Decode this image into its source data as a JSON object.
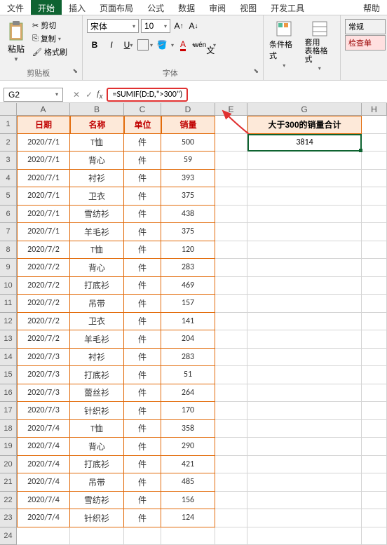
{
  "menu": {
    "file": "文件",
    "home": "开始",
    "insert": "插入",
    "layout": "页面布局",
    "formula": "公式",
    "data": "数据",
    "review": "审阅",
    "view": "视图",
    "dev": "开发工具",
    "help": "帮助"
  },
  "ribbon": {
    "clipboard": {
      "paste": "粘贴",
      "cut": "剪切",
      "copy": "复制",
      "painter": "格式刷",
      "label": "剪贴板"
    },
    "font": {
      "name": "宋体",
      "size": "10",
      "label": "字体"
    },
    "styles": {
      "cond": "条件格式",
      "table": "套用\n表格格式",
      "normal": "常规",
      "check": "检查单"
    }
  },
  "namebox": "G2",
  "formula": "=SUMIF(D:D,\">300\")",
  "headers": {
    "date": "日期",
    "name": "名称",
    "unit": "单位",
    "sales": "销量",
    "g": "大于300的销量合计"
  },
  "gval": "3814",
  "chart_data": {
    "type": "table",
    "columns": [
      "日期",
      "名称",
      "单位",
      "销量"
    ],
    "rows": [
      [
        "2020/7/1",
        "T恤",
        "件",
        "500"
      ],
      [
        "2020/7/1",
        "背心",
        "件",
        "59"
      ],
      [
        "2020/7/1",
        "衬衫",
        "件",
        "393"
      ],
      [
        "2020/7/1",
        "卫衣",
        "件",
        "375"
      ],
      [
        "2020/7/1",
        "雪纺衫",
        "件",
        "438"
      ],
      [
        "2020/7/1",
        "羊毛衫",
        "件",
        "375"
      ],
      [
        "2020/7/2",
        "T恤",
        "件",
        "120"
      ],
      [
        "2020/7/2",
        "背心",
        "件",
        "283"
      ],
      [
        "2020/7/2",
        "打底衫",
        "件",
        "469"
      ],
      [
        "2020/7/2",
        "吊带",
        "件",
        "157"
      ],
      [
        "2020/7/2",
        "卫衣",
        "件",
        "141"
      ],
      [
        "2020/7/2",
        "羊毛衫",
        "件",
        "204"
      ],
      [
        "2020/7/3",
        "衬衫",
        "件",
        "283"
      ],
      [
        "2020/7/3",
        "打底衫",
        "件",
        "51"
      ],
      [
        "2020/7/3",
        "蕾丝衫",
        "件",
        "264"
      ],
      [
        "2020/7/3",
        "针织衫",
        "件",
        "170"
      ],
      [
        "2020/7/4",
        "T恤",
        "件",
        "358"
      ],
      [
        "2020/7/4",
        "背心",
        "件",
        "290"
      ],
      [
        "2020/7/4",
        "打底衫",
        "件",
        "421"
      ],
      [
        "2020/7/4",
        "吊带",
        "件",
        "485"
      ],
      [
        "2020/7/4",
        "雪纺衫",
        "件",
        "156"
      ],
      [
        "2020/7/4",
        "针织衫",
        "件",
        "124"
      ]
    ]
  },
  "cols": [
    "A",
    "B",
    "C",
    "D",
    "E",
    "G",
    "H"
  ]
}
